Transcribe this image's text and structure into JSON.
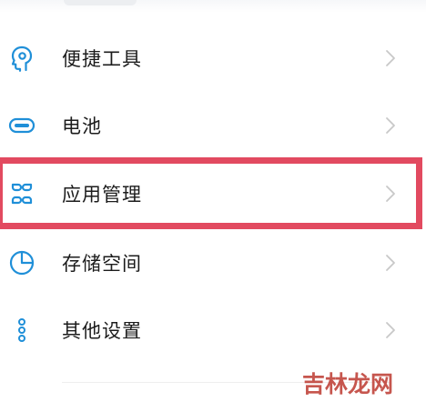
{
  "settings": {
    "items": [
      {
        "label": "便捷工具",
        "icon": "assistant-head-icon"
      },
      {
        "label": "电池",
        "icon": "battery-icon"
      },
      {
        "label": "应用管理",
        "icon": "apps-grid-icon"
      },
      {
        "label": "存储空间",
        "icon": "storage-pie-icon"
      },
      {
        "label": "其他设置",
        "icon": "more-dots-icon"
      }
    ]
  },
  "watermark": {
    "text": "吉林龙网"
  },
  "colors": {
    "icon": "#1f8fd8",
    "highlight": "#e24a60",
    "chevron": "#c8c8c8",
    "text": "#1c1c1c",
    "watermark": "#c2483f"
  }
}
